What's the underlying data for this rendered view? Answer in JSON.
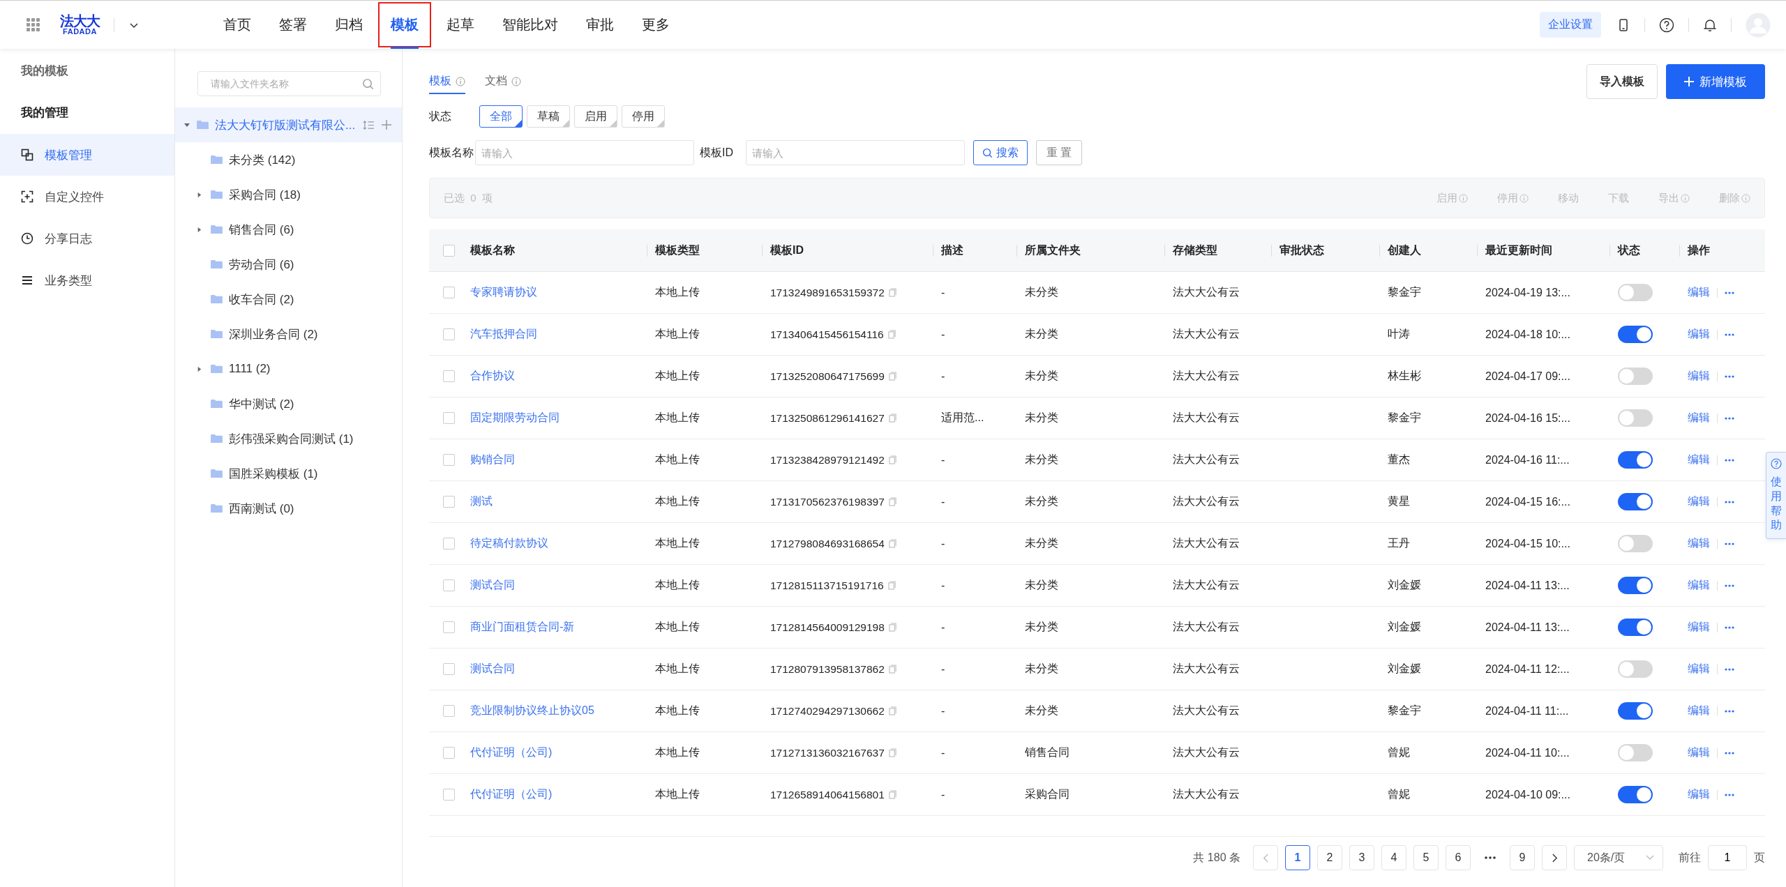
{
  "topbar": {
    "logo_text": "法大大",
    "logo_subtext": "FADADA",
    "nav": [
      {
        "label": "首页",
        "selected": false,
        "highlighted": false
      },
      {
        "label": "签署",
        "selected": false,
        "highlighted": false
      },
      {
        "label": "归档",
        "selected": false,
        "highlighted": false
      },
      {
        "label": "模板",
        "selected": true,
        "highlighted": true
      },
      {
        "label": "起草",
        "selected": false,
        "highlighted": false
      },
      {
        "label": "智能比对",
        "selected": false,
        "highlighted": false
      },
      {
        "label": "审批",
        "selected": false,
        "highlighted": false
      },
      {
        "label": "更多",
        "selected": false,
        "highlighted": false
      }
    ],
    "enterprise_button": "企业设置"
  },
  "sidebar": {
    "section_title": "我的模板",
    "manage_title": "我的管理",
    "items": [
      {
        "label": "模板管理",
        "selected": true
      },
      {
        "label": "自定义控件",
        "selected": false
      },
      {
        "label": "分享日志",
        "selected": false
      },
      {
        "label": "业务类型",
        "selected": false
      }
    ]
  },
  "folders": {
    "search_placeholder": "请输入文件夹名称",
    "root": {
      "label": "法大大钉钉版测试有限公...",
      "expanded": true,
      "selected": true,
      "children": [
        {
          "label": "未分类 (142)",
          "has_children": false
        },
        {
          "label": "采购合同 (18)",
          "has_children": true
        },
        {
          "label": "销售合同 (6)",
          "has_children": true
        },
        {
          "label": "劳动合同 (6)",
          "has_children": false
        },
        {
          "label": "收车合同 (2)",
          "has_children": false
        },
        {
          "label": "深圳业务合同 (2)",
          "has_children": false
        },
        {
          "label": "1111 (2)",
          "has_children": true
        },
        {
          "label": "华中测试 (2)",
          "has_children": false
        },
        {
          "label": "彭伟强采购合同测试 (1)",
          "has_children": false
        },
        {
          "label": "国胜采购模板 (1)",
          "has_children": false
        },
        {
          "label": "西南测试 (0)",
          "has_children": false
        }
      ]
    }
  },
  "tabs": [
    {
      "label": "模板",
      "selected": true
    },
    {
      "label": "文档",
      "selected": false
    }
  ],
  "status_filter": {
    "label": "状态",
    "options": [
      {
        "label": "全部",
        "selected": true
      },
      {
        "label": "草稿",
        "selected": false
      },
      {
        "label": "启用",
        "selected": false
      },
      {
        "label": "停用",
        "selected": false
      }
    ]
  },
  "search": {
    "name_label": "模板名称",
    "name_placeholder": "请输入",
    "id_label": "模板ID",
    "id_placeholder": "请输入",
    "search_button": "搜索",
    "reset_button": "重 置"
  },
  "actions": {
    "import_button": "导入模板",
    "create_button": "新增模板"
  },
  "bulk_bar": {
    "selected_text": "已选  0  项",
    "actions": [
      {
        "label": "启用",
        "info": true
      },
      {
        "label": "停用",
        "info": true
      },
      {
        "label": "移动",
        "info": false
      },
      {
        "label": "下载",
        "info": false
      },
      {
        "label": "导出",
        "info": true
      },
      {
        "label": "删除",
        "info": true
      }
    ]
  },
  "table": {
    "header_checked": false,
    "columns": [
      "模板名称",
      "模板类型",
      "模板ID",
      "描述",
      "所属文件夹",
      "存储类型",
      "审批状态",
      "创建人",
      "最近更新时间",
      "状态",
      "操作"
    ],
    "rows": [
      {
        "checked": false,
        "name": "专家聘请协议",
        "type": "本地上传",
        "id": "1713249891653159372",
        "description": "-",
        "folder": "未分类",
        "storage": "法大大公有云",
        "creator": "黎金宇",
        "updated": "2024-04-19 13:...",
        "enabled": false,
        "action": "编辑"
      },
      {
        "checked": false,
        "name": "汽车抵押合同",
        "type": "本地上传",
        "id": "1713406415456154116",
        "description": "-",
        "folder": "未分类",
        "storage": "法大大公有云",
        "creator": "叶涛",
        "updated": "2024-04-18 10:...",
        "enabled": true,
        "action": "编辑"
      },
      {
        "checked": false,
        "name": "合作协议",
        "type": "本地上传",
        "id": "1713252080647175699",
        "description": "-",
        "folder": "未分类",
        "storage": "法大大公有云",
        "creator": "林生彬",
        "updated": "2024-04-17 09:...",
        "enabled": false,
        "action": "编辑"
      },
      {
        "checked": false,
        "name": "固定期限劳动合同",
        "type": "本地上传",
        "id": "1713250861296141627",
        "description": "适用范...",
        "folder": "未分类",
        "storage": "法大大公有云",
        "creator": "黎金宇",
        "updated": "2024-04-16 15:...",
        "enabled": false,
        "action": "编辑"
      },
      {
        "checked": false,
        "name": "购销合同",
        "type": "本地上传",
        "id": "1713238428979121492",
        "description": "-",
        "folder": "未分类",
        "storage": "法大大公有云",
        "creator": "董杰",
        "updated": "2024-04-16 11:...",
        "enabled": true,
        "action": "编辑"
      },
      {
        "checked": false,
        "name": "测试",
        "type": "本地上传",
        "id": "1713170562376198397",
        "description": "-",
        "folder": "未分类",
        "storage": "法大大公有云",
        "creator": "黄星",
        "updated": "2024-04-15 16:...",
        "enabled": true,
        "action": "编辑"
      },
      {
        "checked": false,
        "name": "待定稿付款协议",
        "type": "本地上传",
        "id": "1712798084693168654",
        "description": "-",
        "folder": "未分类",
        "storage": "法大大公有云",
        "creator": "王丹",
        "updated": "2024-04-15 10:...",
        "enabled": false,
        "action": "编辑"
      },
      {
        "checked": false,
        "name": "测试合同",
        "type": "本地上传",
        "id": "1712815113715191716",
        "description": "-",
        "folder": "未分类",
        "storage": "法大大公有云",
        "creator": "刘金媛",
        "updated": "2024-04-11 13:...",
        "enabled": true,
        "action": "编辑"
      },
      {
        "checked": false,
        "name": "商业门面租赁合同-新",
        "type": "本地上传",
        "id": "1712814564009129198",
        "description": "-",
        "folder": "未分类",
        "storage": "法大大公有云",
        "creator": "刘金媛",
        "updated": "2024-04-11 13:...",
        "enabled": true,
        "action": "编辑"
      },
      {
        "checked": false,
        "name": "测试合同",
        "type": "本地上传",
        "id": "1712807913958137862",
        "description": "-",
        "folder": "未分类",
        "storage": "法大大公有云",
        "creator": "刘金媛",
        "updated": "2024-04-11 12:...",
        "enabled": false,
        "action": "编辑"
      },
      {
        "checked": false,
        "name": "竞业限制协议终止协议05",
        "type": "本地上传",
        "id": "1712740294297130662",
        "description": "-",
        "folder": "未分类",
        "storage": "法大大公有云",
        "creator": "黎金宇",
        "updated": "2024-04-11 11:...",
        "enabled": true,
        "action": "编辑"
      },
      {
        "checked": false,
        "name": "代付证明（公司)",
        "type": "本地上传",
        "id": "1712713136032167637",
        "description": "-",
        "folder": "销售合同",
        "storage": "法大大公有云",
        "creator": "曾妮",
        "updated": "2024-04-11 10:...",
        "enabled": false,
        "action": "编辑"
      },
      {
        "checked": false,
        "name": "代付证明（公司)",
        "type": "本地上传",
        "id": "1712658914064156801",
        "description": "-",
        "folder": "采购合同",
        "storage": "法大大公有云",
        "creator": "曾妮",
        "updated": "2024-04-10 09:...",
        "enabled": true,
        "action": "编辑"
      }
    ]
  },
  "pagination": {
    "total": "共 180 条",
    "pages": [
      {
        "label": "1",
        "selected": true
      },
      {
        "label": "2",
        "selected": false
      },
      {
        "label": "3",
        "selected": false
      },
      {
        "label": "4",
        "selected": false
      },
      {
        "label": "5",
        "selected": false
      },
      {
        "label": "6",
        "selected": false
      }
    ],
    "last_pages": [
      {
        "label": "9",
        "selected": false
      }
    ],
    "page_size": "20条/页",
    "goto_label": "前往",
    "goto_value": "1",
    "page_suffix": "页"
  },
  "help_tab": "使用帮助"
}
